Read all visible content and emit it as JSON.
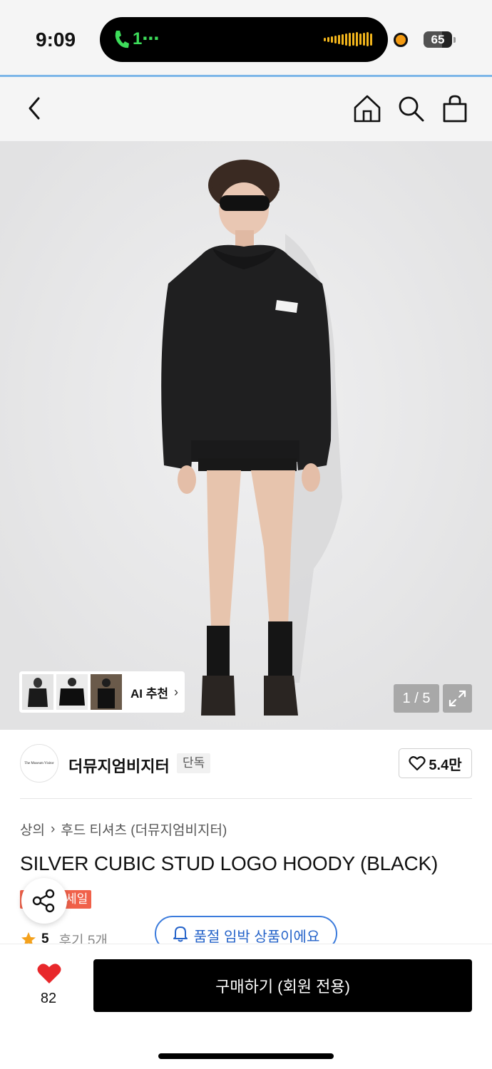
{
  "status_bar": {
    "time": "9:09",
    "call_label": "1⋯",
    "battery": "65"
  },
  "nav": {
    "back_icon": "chevron-left-icon",
    "home_icon": "home-icon",
    "search_icon": "search-icon",
    "bag_icon": "shopping-bag-icon"
  },
  "gallery": {
    "ai_label": "AI 추천",
    "ai_arrow": "›",
    "counter": "1 / 5"
  },
  "brand": {
    "logo_text": "The Museum Visitor",
    "name": "더뮤지엄비지터",
    "badge": "단독",
    "likes": "5.4만"
  },
  "product": {
    "breadcrumb_category": "상의",
    "breadcrumb_separator": "›",
    "breadcrumb_sub": "후드 티셔츠 (더뮤지엄비지터)",
    "title": "SILVER CUBIC STUD LOGO HOODY (BLACK)",
    "sale_badge": "세일",
    "rating": "5",
    "reviews": "후기 5개",
    "stock_notice": "품절 임박 상품이에요"
  },
  "bottom": {
    "like_count": "82",
    "buy_label": "구매하기 (회원 전용)"
  },
  "colors": {
    "accent_blue": "#2563c9",
    "sale_red": "#f0614a",
    "heart_red": "#e8282b",
    "star_orange": "#f4a11c",
    "call_green": "#3ddc5a"
  }
}
